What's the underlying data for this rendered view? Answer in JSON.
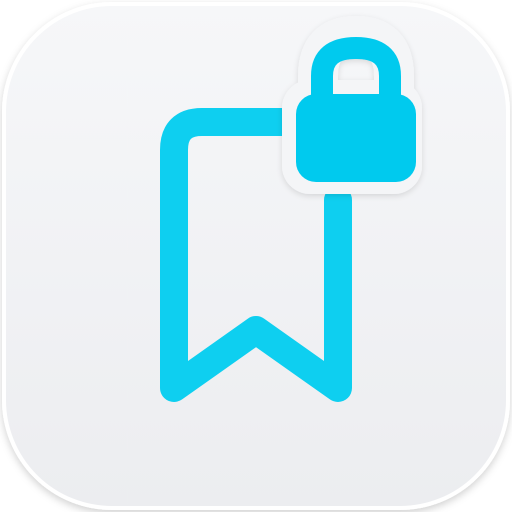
{
  "icon": {
    "glyph": "bookmark-lock-icon",
    "subglyph": "padlock-icon"
  },
  "colors": {
    "accent": "#0ECFF0",
    "lock": "#06CAEE",
    "tile_top": "#F6F7F9",
    "tile_bottom": "#ECEDF0",
    "tile_border": "#FFFFFF"
  }
}
